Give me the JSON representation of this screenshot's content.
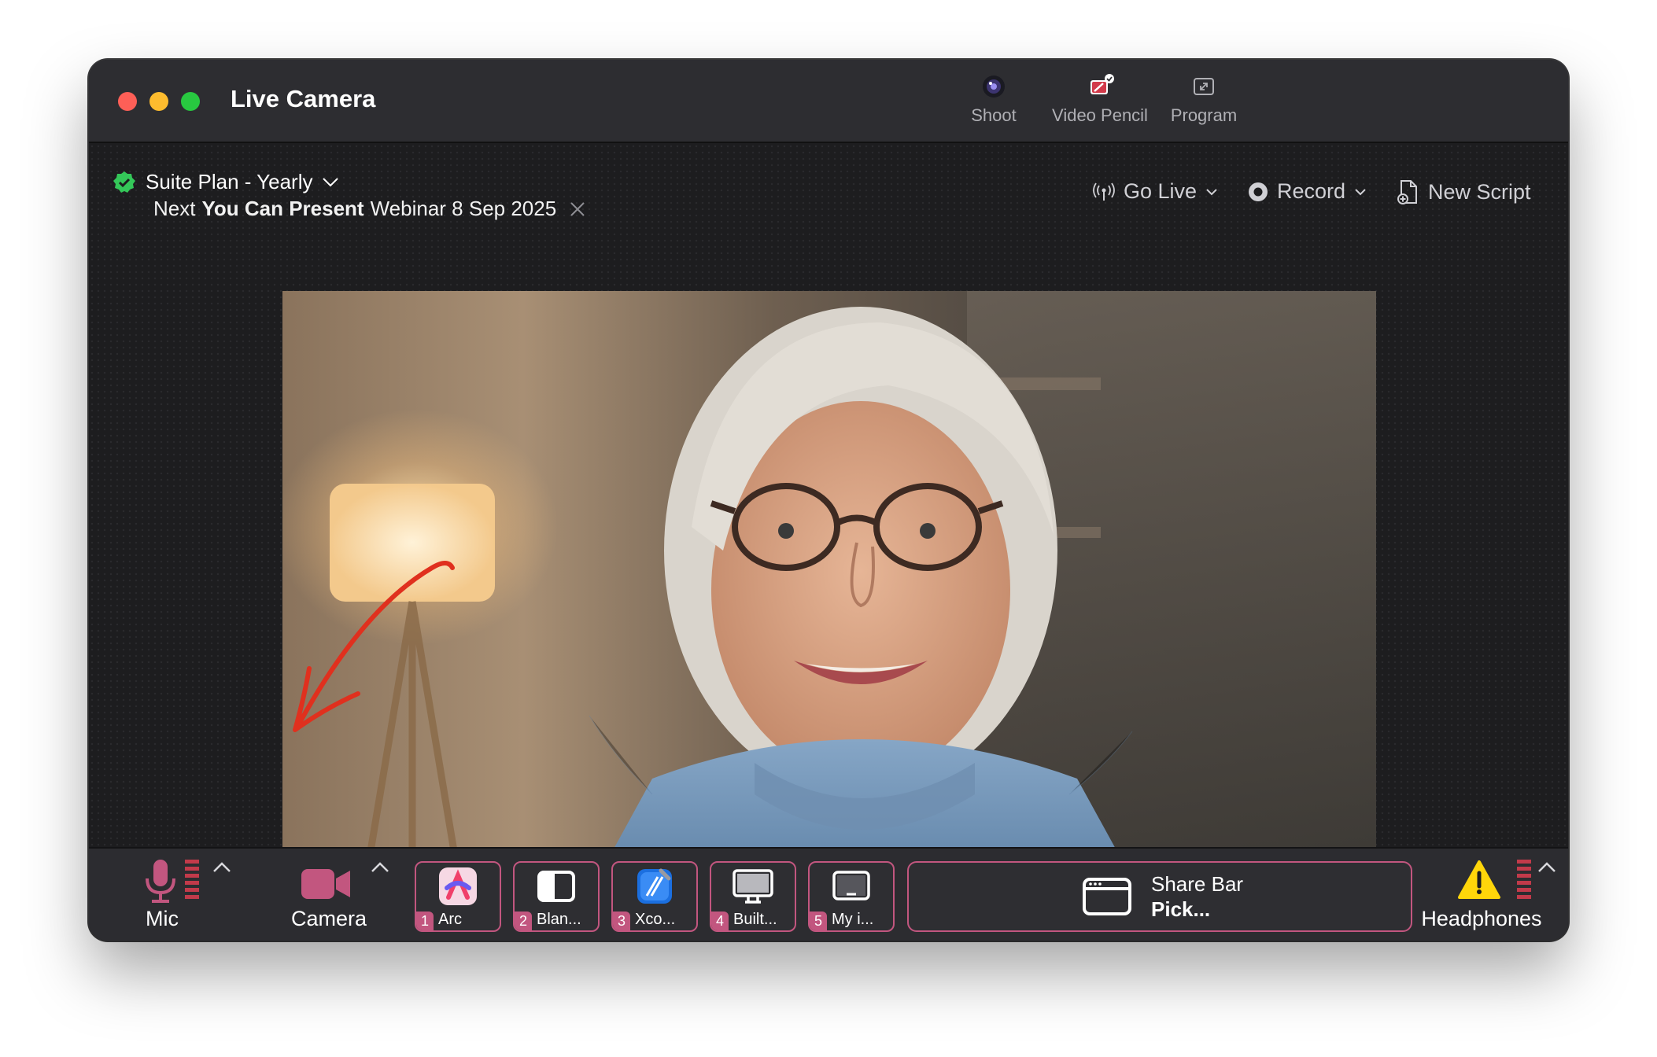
{
  "window": {
    "title": "Live Camera",
    "toolbar": [
      {
        "label": "Shoot",
        "icon": "lens-icon"
      },
      {
        "label": "Video Pencil",
        "icon": "video-pencil-icon"
      },
      {
        "label": "Program",
        "icon": "expand-icon"
      }
    ]
  },
  "header": {
    "plan": "Suite Plan - Yearly",
    "next_prefix": "Next",
    "next_event": "You Can Present",
    "next_suffix": "Webinar 8 Sep 2025",
    "go_live": "Go Live",
    "record": "Record",
    "new_script": "New Script"
  },
  "bottom_bar": {
    "mic_label": "Mic",
    "camera_label": "Camera",
    "apps": [
      {
        "num": "1",
        "name": "Arc",
        "icon": "arc-icon"
      },
      {
        "num": "2",
        "name": "Blan...",
        "icon": "blank-window-icon"
      },
      {
        "num": "3",
        "name": "Xco...",
        "icon": "xcode-icon"
      },
      {
        "num": "4",
        "name": "Built...",
        "icon": "monitor-icon"
      },
      {
        "num": "5",
        "name": "My i...",
        "icon": "laptop-icon"
      }
    ],
    "share_title": "Share Bar",
    "share_action": "Pick...",
    "headphones_label": "Headphones"
  },
  "colors": {
    "accent": "#c2567f",
    "verified": "#34c759",
    "annotation": "#e0301e",
    "warning": "#ffd60a"
  }
}
